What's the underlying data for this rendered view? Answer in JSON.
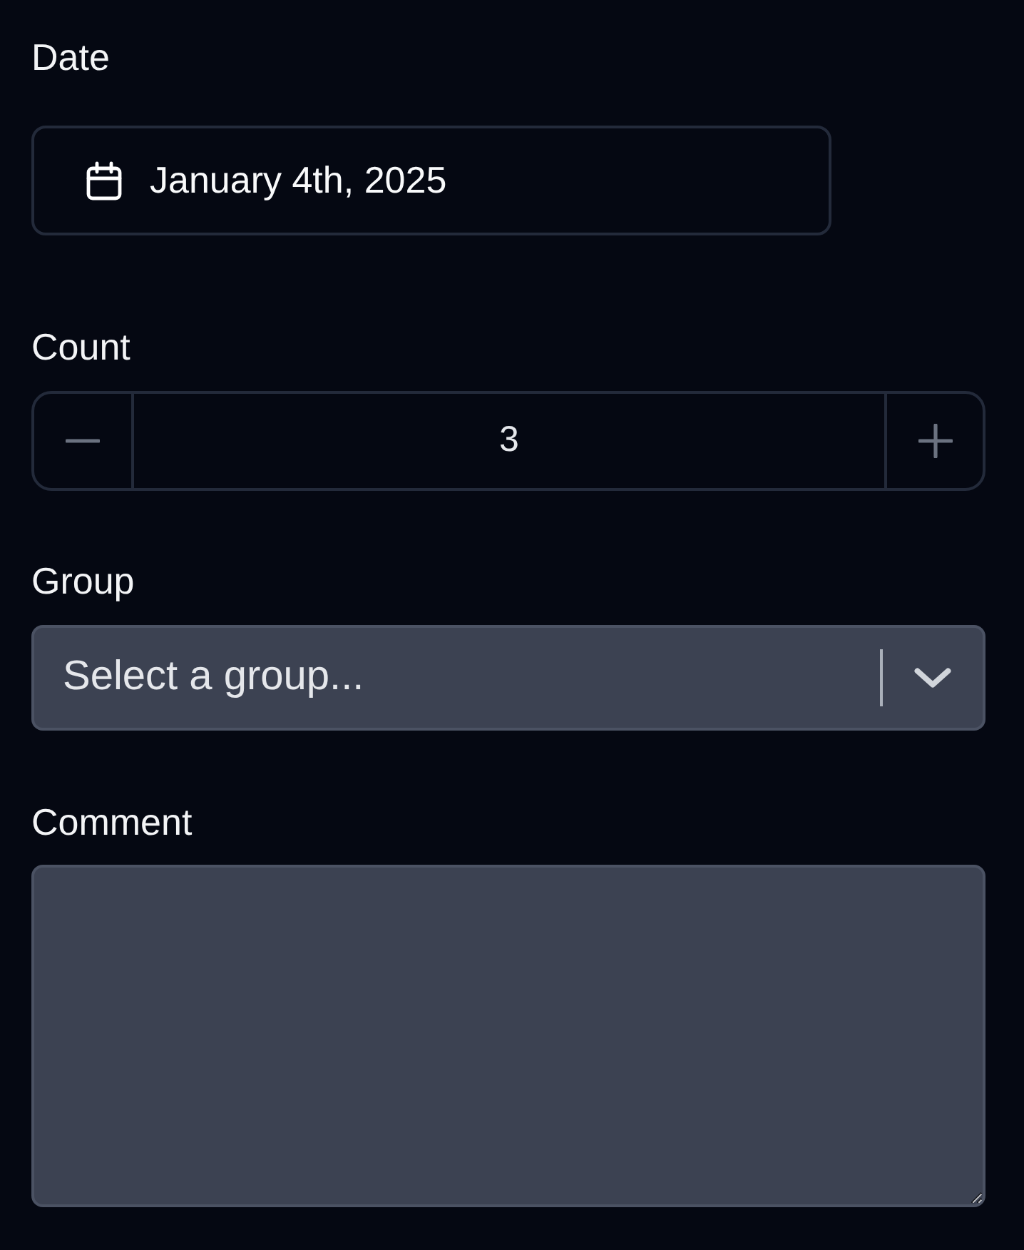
{
  "fields": [
    {
      "kind": "date",
      "label": "Date",
      "value": "January 4th, 2025"
    },
    {
      "kind": "stepper",
      "label": "Count",
      "value": "3"
    },
    {
      "kind": "select",
      "label": "Group",
      "placeholder": "Select a group..."
    },
    {
      "kind": "textarea",
      "label": "Comment"
    }
  ]
}
